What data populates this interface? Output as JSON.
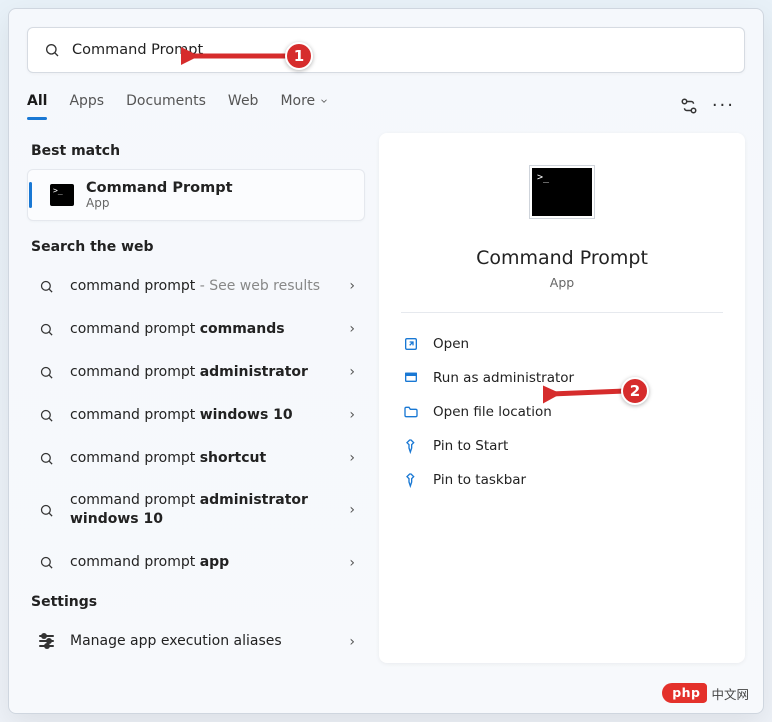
{
  "search": {
    "value": "Command Prompt"
  },
  "tabs": {
    "all": "All",
    "apps": "Apps",
    "documents": "Documents",
    "web": "Web",
    "more": "More"
  },
  "sections": {
    "best_match": "Best match",
    "search_web": "Search the web",
    "settings": "Settings"
  },
  "best_match": {
    "title": "Command Prompt",
    "subtitle": "App"
  },
  "web_results": [
    {
      "prefix": "command prompt",
      "bold": "",
      "suffix": " - See web results"
    },
    {
      "prefix": "command prompt ",
      "bold": "commands",
      "suffix": ""
    },
    {
      "prefix": "command prompt ",
      "bold": "administrator",
      "suffix": ""
    },
    {
      "prefix": "command prompt ",
      "bold": "windows 10",
      "suffix": ""
    },
    {
      "prefix": "command prompt ",
      "bold": "shortcut",
      "suffix": ""
    },
    {
      "prefix": "command prompt ",
      "bold": "administrator windows 10",
      "suffix": ""
    },
    {
      "prefix": "command prompt ",
      "bold": "app",
      "suffix": ""
    }
  ],
  "settings_items": [
    {
      "label": "Manage app execution aliases"
    }
  ],
  "preview": {
    "title": "Command Prompt",
    "subtitle": "App"
  },
  "actions": {
    "open": "Open",
    "run_admin": "Run as administrator",
    "open_loc": "Open file location",
    "pin_start": "Pin to Start",
    "pin_taskbar": "Pin to taskbar"
  },
  "callouts": {
    "one": "1",
    "two": "2"
  },
  "watermark": {
    "brand": "php",
    "text": "中文网"
  }
}
